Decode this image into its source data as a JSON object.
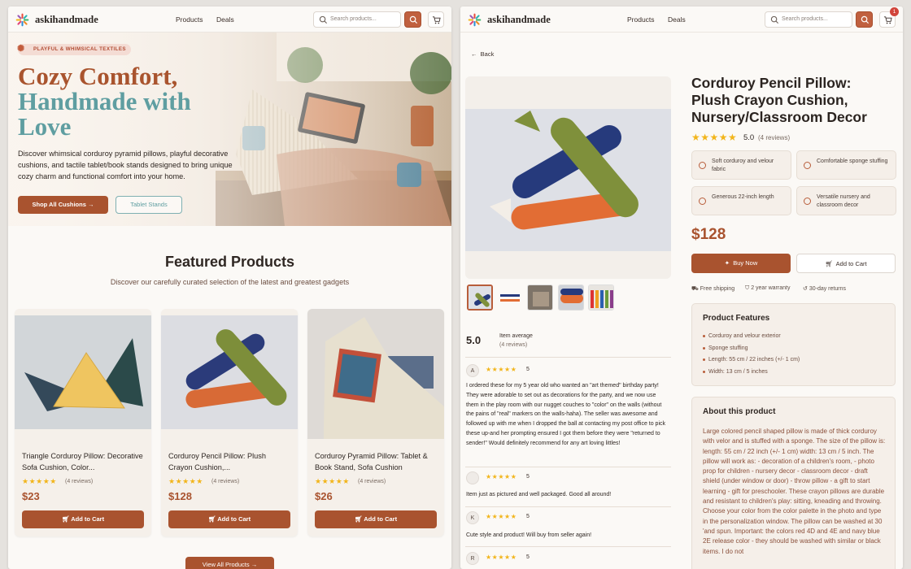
{
  "brand": "askihandmade",
  "nav": {
    "products": "Products",
    "deals": "Deals",
    "search_placeholder": "Search products..."
  },
  "cart_count": "1",
  "hero": {
    "tag": "PLAYFUL & WHIMSICAL TEXTILES",
    "line1": "Cozy Comfort,",
    "line2": "Handmade with",
    "line3": "Love",
    "desc": "Discover whimsical corduroy pyramid pillows, playful decorative cushions, and tactile tablet/book stands designed to bring unique cozy charm and functional comfort into your home.",
    "shop_btn": "Shop All Cushions",
    "tablet_btn": "Tablet Stands"
  },
  "featured": {
    "title": "Featured Products",
    "subtitle": "Discover our carefully curated selection of the latest and greatest gadgets",
    "view_all": "View All Products"
  },
  "products": [
    {
      "title": "Triangle Corduroy Pillow: Decorative Sofa Cushion, Color...",
      "rating": "★★★★★",
      "reviews": "(4 reviews)",
      "price": "$23",
      "cta": "Add to Cart"
    },
    {
      "title": "Corduroy Pencil Pillow: Plush Crayon Cushion,...",
      "rating": "★★★★★",
      "reviews": "(4 reviews)",
      "price": "$128",
      "cta": "Add to Cart"
    },
    {
      "title": "Corduroy Pyramid Pillow: Tablet & Book Stand, Sofa Cushion",
      "rating": "★★★★★",
      "reviews": "(4 reviews)",
      "price": "$26",
      "cta": "Add to Cart"
    }
  ],
  "detail": {
    "back": "Back",
    "title": "Corduroy Pencil Pillow: Plush Crayon Cushion, Nursery/Classroom Decor",
    "stars": "★★★★★",
    "rating": "5.0",
    "reviews": "(4 reviews)",
    "features": [
      "Soft corduroy and velour fabric",
      "Comfortable sponge stuffing",
      "Generous 22-inch length",
      "Versatile nursery and classroom decor"
    ],
    "price": "$128",
    "buy_now": "Buy Now",
    "add_to_cart": "Add to Cart",
    "shipping": "Free shipping",
    "warranty": "2 year warranty",
    "returns": "30-day returns",
    "product_features_title": "Product Features",
    "product_features": [
      "Corduroy and velour exterior",
      "Sponge stuffing",
      "Length: 55 cm / 22 inches (+/- 1 cm)",
      "Width: 13 cm / 5 inches"
    ],
    "about_title": "About this product",
    "about_text": "Large colored pencil shaped pillow is made of thick corduroy with velor and is stuffed with a sponge. The size of the pillow is: length: 55 cm / 22 inch (+/- 1 cm) width: 13 cm / 5 inch. The pillow will work as: - decoration of a children's room, - photo prop for children - nursery decor - classroom decor - draft shield (under window or door) - throw pillow - a gift to start learning - gift for preschooler. These crayon pillows are durable and resistant to children's play: sitting, kneading and throwing. Choose your color from the color palette in the photo and type in the personalization window. The pillow can be washed at 30 'and spun. Important: the colors red 4D and 4E and navy blue 2E release color - they should be washed with similar or black items. I do not",
    "avg_score": "5.0",
    "avg_label": "Item average",
    "avg_reviews": "(4 reviews)",
    "reviews_list": [
      {
        "initial": "A",
        "stars": "★★★★★",
        "score": "5",
        "text": "I ordered these for my 5 year old who wanted an \"art themed\" birthday party! They were adorable to set out as decorations for the party, and we now use them in the play room with our nugget couches to \"color\" on the walls (without the pains of \"real\" markers on the walls-haha). The seller was awesome and followed up with me when I dropped the ball at contacting my post office to pick these up-and her prompting ensured I got them before they were \"returned to sender!\" Would definitely recommend for any art loving littles!"
      },
      {
        "initial": "",
        "stars": "★★★★★",
        "score": "5",
        "text": "Item just as pictured and well packaged. Good all around!"
      },
      {
        "initial": "K",
        "stars": "★★★★★",
        "score": "5",
        "text": "Cute style and product! Will buy from seller again!"
      },
      {
        "initial": "R",
        "stars": "★★★★★",
        "score": "5",
        "text": ""
      }
    ]
  },
  "colors": {
    "accent": "#a9532f",
    "teal": "#5f9ea1",
    "star": "#f2b51b",
    "bg": "#fbf9f6"
  }
}
